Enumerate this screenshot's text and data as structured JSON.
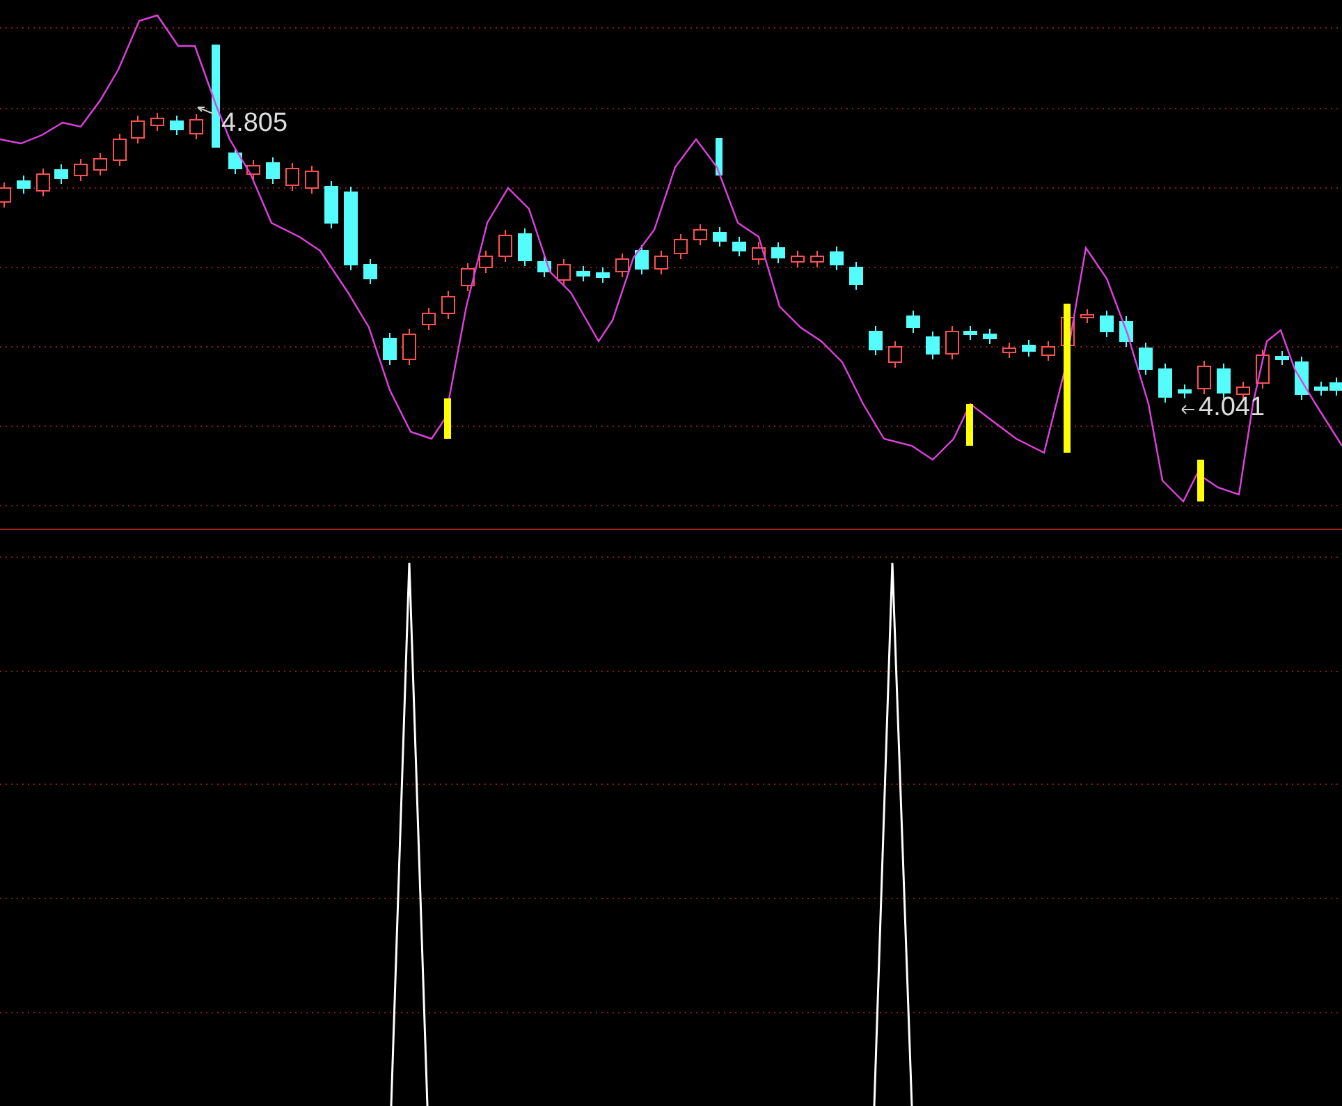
{
  "main_chart": {
    "high_price_label": "4.805",
    "low_price_label": "4.041"
  }
}
